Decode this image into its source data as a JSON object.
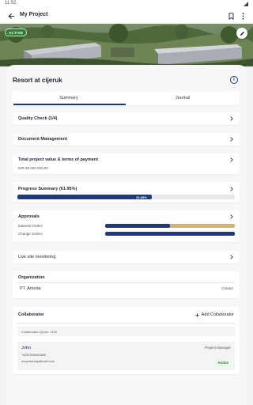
{
  "status_bar": {
    "time": "11:52"
  },
  "app_bar": {
    "title": "My Project",
    "back_icon": "arrow-left-icon",
    "bookmark_icon": "bookmark-icon",
    "menu_icon": "more-vert-icon"
  },
  "hero": {
    "badge": "ACTIVE",
    "edit_icon": "pencil-icon"
  },
  "project": {
    "title": "Resort at cijeruk",
    "info_icon": "info-icon"
  },
  "tabs": [
    {
      "label": "Summary",
      "selected": true
    },
    {
      "label": "Journal",
      "selected": false
    }
  ],
  "sections": {
    "quality_check": {
      "label": "Quality Check (1/4)"
    },
    "document_management": {
      "label": "Document Management"
    },
    "project_value": {
      "label": "Total project value & terms of payment",
      "value": "IDR 65.000.000,00"
    },
    "progress": {
      "label": "Progress Summary (61.95%)",
      "bar_label": "61.95%",
      "fraction": 0.6195
    },
    "approvals": {
      "label": "Approvals",
      "rows": [
        {
          "label": "Material Orders",
          "fraction": 0.5
        },
        {
          "label": "Change Orders",
          "fraction": 1.0
        }
      ]
    },
    "live_monitoring": {
      "label": "Live site monitoring"
    },
    "organization": {
      "label": "Organization",
      "name": "PT. Amoda",
      "role": "Creator"
    },
    "collaborator": {
      "label": "Collaborator",
      "add_label": "Add Collaborator",
      "quota": "Collaborator Quota : 0/10",
      "members": [
        {
          "name": "John",
          "phone": "+6287808050800",
          "email": "ucupmantap@mail.com",
          "role": "Project Manager",
          "status": "Active"
        }
      ]
    }
  },
  "colors": {
    "primary": "#1f3a7a",
    "pending": "#d4b565",
    "active_green": "#2e7d32",
    "track": "#e6e8ec"
  }
}
